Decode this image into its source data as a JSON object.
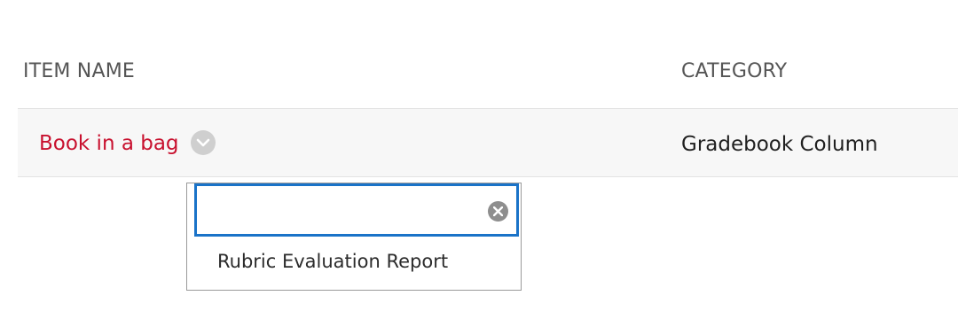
{
  "table": {
    "headers": {
      "item_name": "ITEM NAME",
      "category": "CATEGORY"
    },
    "rows": [
      {
        "item_name": "Book in a bag",
        "category": "Gradebook Column"
      }
    ]
  },
  "context_menu": {
    "search": {
      "value": "",
      "placeholder": ""
    },
    "items": [
      {
        "label": "Rubric Evaluation Report"
      }
    ]
  },
  "colors": {
    "link": "#c8102e",
    "focus_border": "#1a73c8",
    "row_background": "#f7f7f7"
  },
  "icons": {
    "row_menu": "chevron-down-icon",
    "clear": "clear-icon"
  }
}
